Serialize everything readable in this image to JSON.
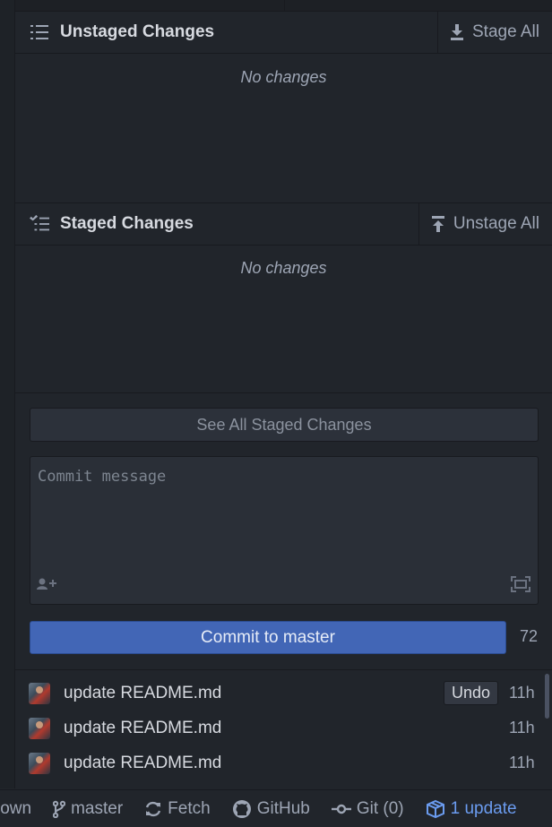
{
  "unstaged": {
    "title": "Unstaged Changes",
    "action_label": "Stage All",
    "empty_text": "No changes"
  },
  "staged": {
    "title": "Staged Changes",
    "action_label": "Unstage All",
    "empty_text": "No changes"
  },
  "see_all_label": "See All Staged Changes",
  "commit": {
    "placeholder": "Commit message",
    "button_label": "Commit to master",
    "char_count": "72"
  },
  "recent_commits": [
    {
      "message": "update README.md",
      "time": "11h",
      "undo_label": "Undo"
    },
    {
      "message": "update README.md",
      "time": "11h"
    },
    {
      "message": "update README.md",
      "time": "11h"
    }
  ],
  "statusbar": {
    "first_label": "lown",
    "branch": "master",
    "fetch": "Fetch",
    "github": "GitHub",
    "git": "Git (0)",
    "update": "1 update"
  },
  "colors": {
    "background": "#21252b",
    "accent": "#4266b6",
    "update_link": "#6b9cf0"
  },
  "icons": [
    "list-icon",
    "download-icon",
    "checklist-icon",
    "upload-icon",
    "add-coauthor-icon",
    "expand-icon",
    "git-branch-icon",
    "sync-icon",
    "github-icon",
    "git-commit-icon",
    "package-icon"
  ]
}
